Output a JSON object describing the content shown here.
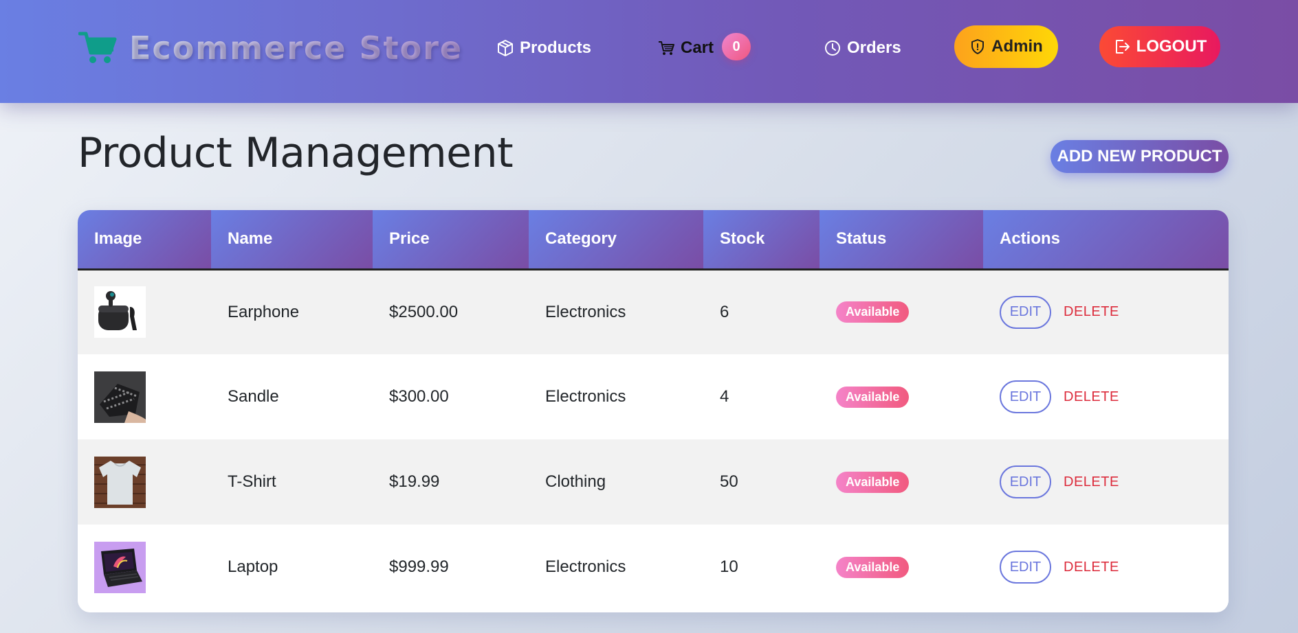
{
  "navbar": {
    "brand": "Ecommerce Store",
    "products_label": "Products",
    "cart_label": "Cart",
    "cart_count": "0",
    "orders_label": "Orders",
    "admin_label": "Admin",
    "logout_label": "LOGOUT"
  },
  "page": {
    "title": "Product Management",
    "add_button": "ADD NEW PRODUCT"
  },
  "table": {
    "headers": [
      "Image",
      "Name",
      "Price",
      "Category",
      "Stock",
      "Status",
      "Actions"
    ],
    "rows": [
      {
        "name": "Earphone",
        "price": "$2500.00",
        "category": "Electronics",
        "stock": "6",
        "status": "Available",
        "edit": "EDIT",
        "delete": "DELETE",
        "image": "earphone-image"
      },
      {
        "name": "Sandle",
        "price": "$300.00",
        "category": "Electronics",
        "stock": "4",
        "status": "Available",
        "edit": "EDIT",
        "delete": "DELETE",
        "image": "sandal-image"
      },
      {
        "name": "T-Shirt",
        "price": "$19.99",
        "category": "Clothing",
        "stock": "50",
        "status": "Available",
        "edit": "EDIT",
        "delete": "DELETE",
        "image": "tshirt-image"
      },
      {
        "name": "Laptop",
        "price": "$999.99",
        "category": "Electronics",
        "stock": "10",
        "status": "Available",
        "edit": "EDIT",
        "delete": "DELETE",
        "image": "laptop-image"
      }
    ]
  },
  "colors": {
    "nav_gradient_start": "#6a7fe3",
    "nav_gradient_end": "#7a4da5",
    "admin_gradient": "#fda21c",
    "logout_gradient": "#fb4a35",
    "status_pill": "#f483c8",
    "edit_outline": "#6a76dd",
    "delete_text": "#dc2b3b"
  }
}
